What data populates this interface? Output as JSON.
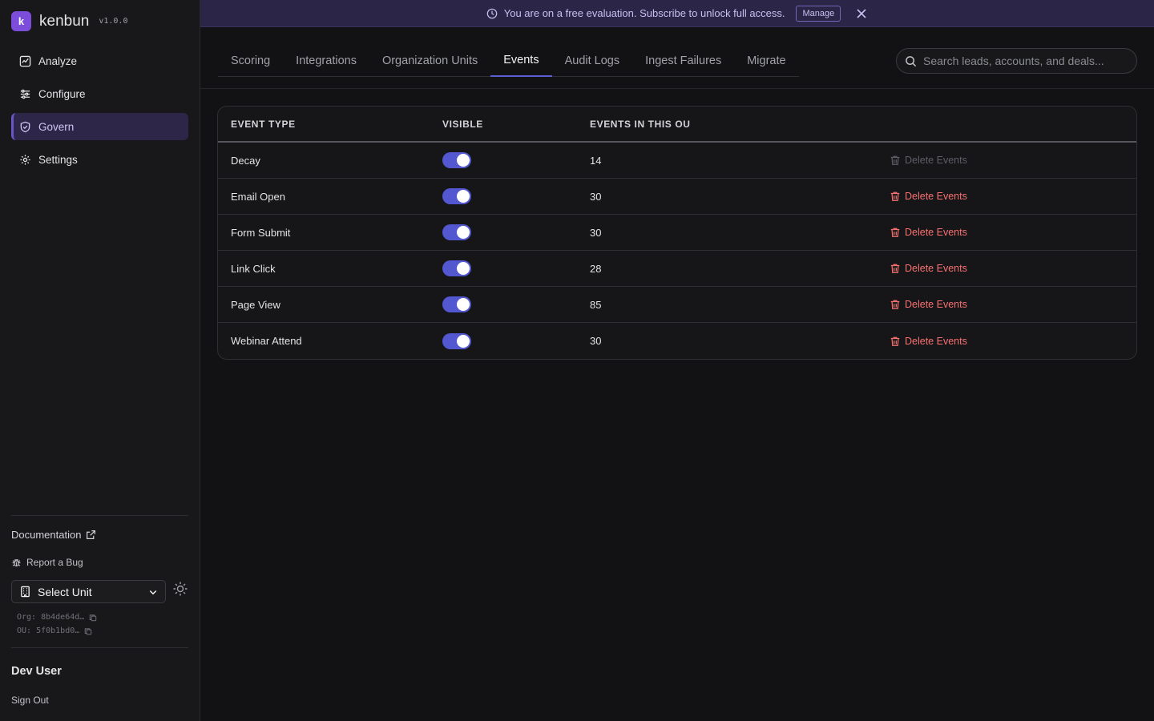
{
  "app": {
    "name": "kenbun",
    "version": "v1.0.0",
    "logo_text": "k"
  },
  "sidebar": {
    "items": [
      {
        "label": "Analyze",
        "icon": "chart-square-icon",
        "active": false
      },
      {
        "label": "Configure",
        "icon": "sliders-icon",
        "active": false
      },
      {
        "label": "Govern",
        "icon": "shield-icon",
        "active": true
      },
      {
        "label": "Settings",
        "icon": "gear-icon",
        "active": false
      }
    ],
    "documentation": "Documentation",
    "report_bug": "Report a Bug",
    "unit_select": "Select Unit",
    "org_label": "Org: 8b4de64d…",
    "ou_label": "OU: 5f0b1bd0…",
    "user_name": "Dev User",
    "sign_out": "Sign Out"
  },
  "banner": {
    "message": "You are on a free evaluation. Subscribe to unlock full access.",
    "manage_label": "Manage"
  },
  "tabs": [
    {
      "label": "Scoring",
      "active": false
    },
    {
      "label": "Integrations",
      "active": false
    },
    {
      "label": "Organization Units",
      "active": false
    },
    {
      "label": "Events",
      "active": true
    },
    {
      "label": "Audit Logs",
      "active": false
    },
    {
      "label": "Ingest Failures",
      "active": false
    },
    {
      "label": "Migrate",
      "active": false
    }
  ],
  "search": {
    "placeholder": "Search leads, accounts, and deals..."
  },
  "table": {
    "headers": [
      "EVENT TYPE",
      "VISIBLE",
      "EVENTS IN THIS OU"
    ],
    "delete_label": "Delete Events",
    "rows": [
      {
        "type": "Decay",
        "visible": true,
        "count": "14",
        "delete_enabled": false
      },
      {
        "type": "Email Open",
        "visible": true,
        "count": "30",
        "delete_enabled": true
      },
      {
        "type": "Form Submit",
        "visible": true,
        "count": "30",
        "delete_enabled": true
      },
      {
        "type": "Link Click",
        "visible": true,
        "count": "28",
        "delete_enabled": true
      },
      {
        "type": "Page View",
        "visible": true,
        "count": "85",
        "delete_enabled": true
      },
      {
        "type": "Webinar Attend",
        "visible": true,
        "count": "30",
        "delete_enabled": true
      }
    ]
  },
  "colors": {
    "accent": "#5b5fd6",
    "danger": "#f87171",
    "banner_bg": "#2b2547",
    "active_nav": "#2d2648"
  }
}
